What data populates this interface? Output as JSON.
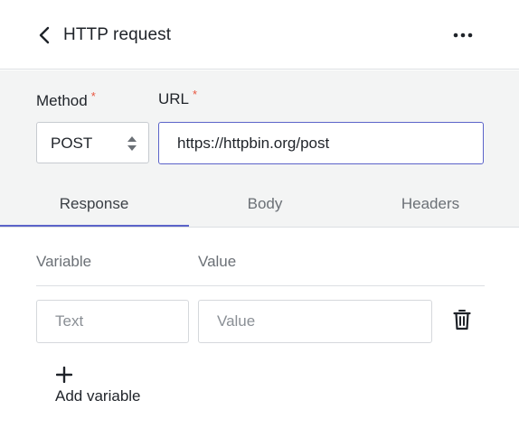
{
  "header": {
    "title": "HTTP request",
    "back_icon": "chevron-left-icon",
    "more_icon": "more-horizontal-icon"
  },
  "request": {
    "method_label": "Method",
    "url_label": "URL",
    "required_marker": "*",
    "method_value": "POST",
    "url_value": "https://httpbin.org/post"
  },
  "tabs": [
    {
      "label": "Response",
      "active": true
    },
    {
      "label": "Body",
      "active": false
    },
    {
      "label": "Headers",
      "active": false
    }
  ],
  "response": {
    "columns": [
      "Variable",
      "Value"
    ],
    "rows": [
      {
        "variable_placeholder": "Text",
        "value_placeholder": "Value",
        "variable_value": "",
        "value_value": ""
      }
    ],
    "add_label": "Add variable"
  },
  "colors": {
    "accent": "#5b63c9",
    "required": "#e8553f",
    "section_bg": "#f3f4f4"
  }
}
